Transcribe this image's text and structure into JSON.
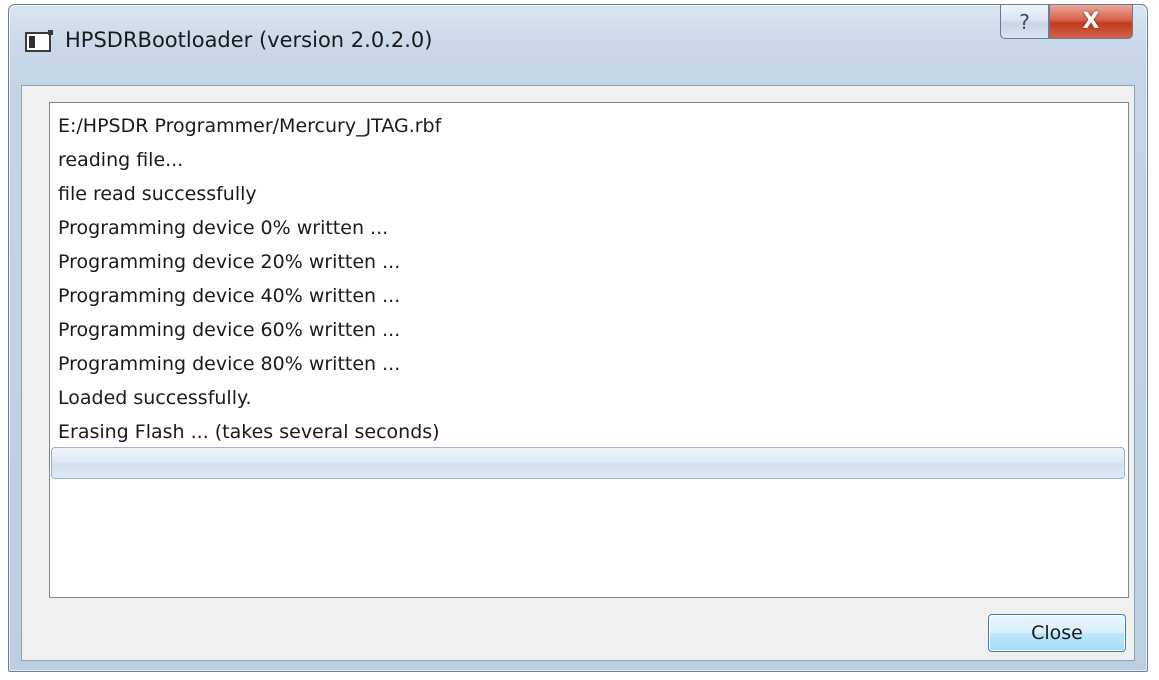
{
  "window": {
    "title": "HPSDRBootloader (version 2.0.2.0)",
    "icon": "app-window-icon"
  },
  "caption_buttons": {
    "help_label": "?",
    "close_label": "X"
  },
  "log": {
    "lines": [
      "E:/HPSDR Programmer/Mercury_JTAG.rbf",
      "reading file...",
      "file read successfully",
      "Programming device 0% written ...",
      "Programming device 20% written ...",
      "Programming device 40% written ...",
      "Programming device 60% written ...",
      "Programming device 80% written ...",
      "Loaded successfully.",
      "Erasing Flash ... (takes several seconds)"
    ]
  },
  "progress": {
    "value": 0
  },
  "buttons": {
    "close_label": "Close"
  },
  "colors": {
    "close_caption": "#c23a1f",
    "progress_fill": "#4ec24e"
  }
}
